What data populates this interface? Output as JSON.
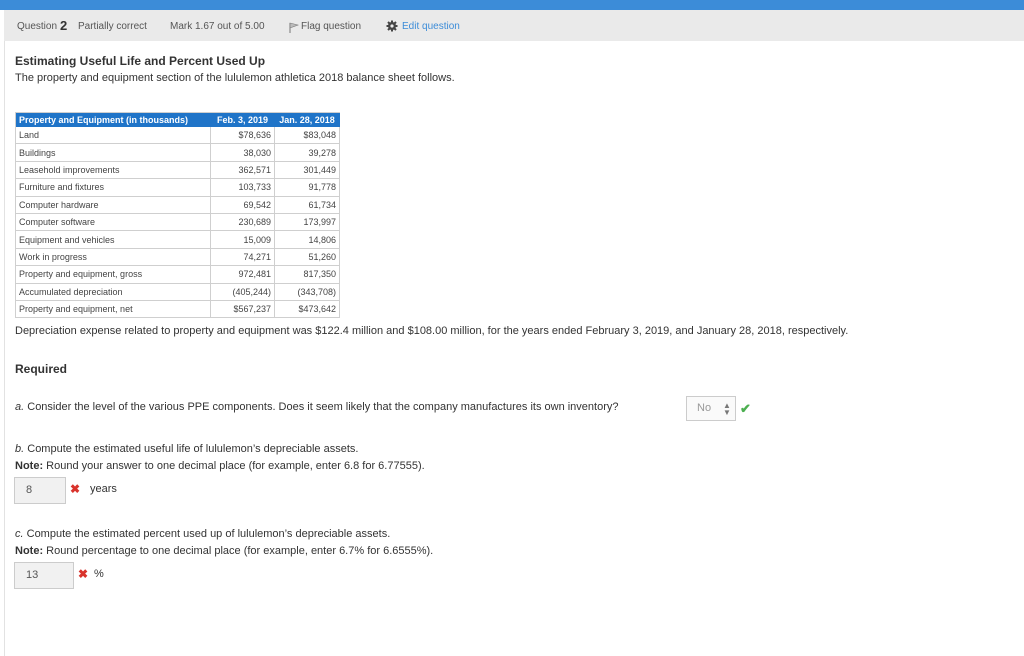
{
  "question_bar": {
    "question_label": "Question",
    "question_number": "2",
    "status": "Partially correct",
    "mark": "Mark 1.67 out of 5.00",
    "flag": "Flag question",
    "edit": "Edit question"
  },
  "title": "Estimating Useful Life and Percent Used Up",
  "intro": "The property and equipment section of the lululemon athletica 2018 balance sheet follows.",
  "table": {
    "headers": [
      "Property and Equipment (in thousands)",
      "Feb. 3, 2019",
      "Jan. 28, 2018"
    ],
    "rows": [
      [
        "Land",
        "$78,636",
        "$83,048"
      ],
      [
        "Buildings",
        "38,030",
        "39,278"
      ],
      [
        "Leasehold improvements",
        "362,571",
        "301,449"
      ],
      [
        "Furniture and fixtures",
        "103,733",
        "91,778"
      ],
      [
        "Computer hardware",
        "69,542",
        "61,734"
      ],
      [
        "Computer software",
        "230,689",
        "173,997"
      ],
      [
        "Equipment and vehicles",
        "15,009",
        "14,806"
      ],
      [
        "Work in progress",
        "74,271",
        "51,260"
      ],
      [
        "Property and equipment, gross",
        "972,481",
        "817,350"
      ],
      [
        "Accumulated depreciation",
        "(405,244)",
        "(343,708)"
      ],
      [
        "Property and equipment, net",
        "$567,237",
        "$473,642"
      ]
    ]
  },
  "depreciation_text": "Depreciation expense related to property and equipment was $122.4 million and $108.00 million, for the years ended February 3, 2019, and January 28, 2018, respectively.",
  "required_label": "Required",
  "part_a": {
    "letter": "a.",
    "text": "Consider the level of the various PPE components. Does it seem likely that the company manufactures its own inventory?",
    "selected": "No",
    "check": "✔"
  },
  "part_b": {
    "letter": "b.",
    "text": "Compute the estimated useful life of lululemon’s depreciable assets.",
    "note_label": "Note:",
    "note_text": "Round your answer to one decimal place (for example, enter 6.8 for 6.77555).",
    "value": "8",
    "x": "✖",
    "unit": "years"
  },
  "part_c": {
    "letter": "c.",
    "text": "Compute the estimated percent used up of lululemon’s depreciable assets.",
    "note_label": "Note:",
    "note_text": "Round percentage to one decimal place (for example, enter 6.7% for 6.6555%).",
    "value": "13",
    "x": "✖",
    "unit": "%"
  },
  "colors": {
    "accent": "#3c8cd8",
    "table_header": "#1f74c8",
    "incorrect": "#d9332c",
    "correct": "#4caf50"
  }
}
